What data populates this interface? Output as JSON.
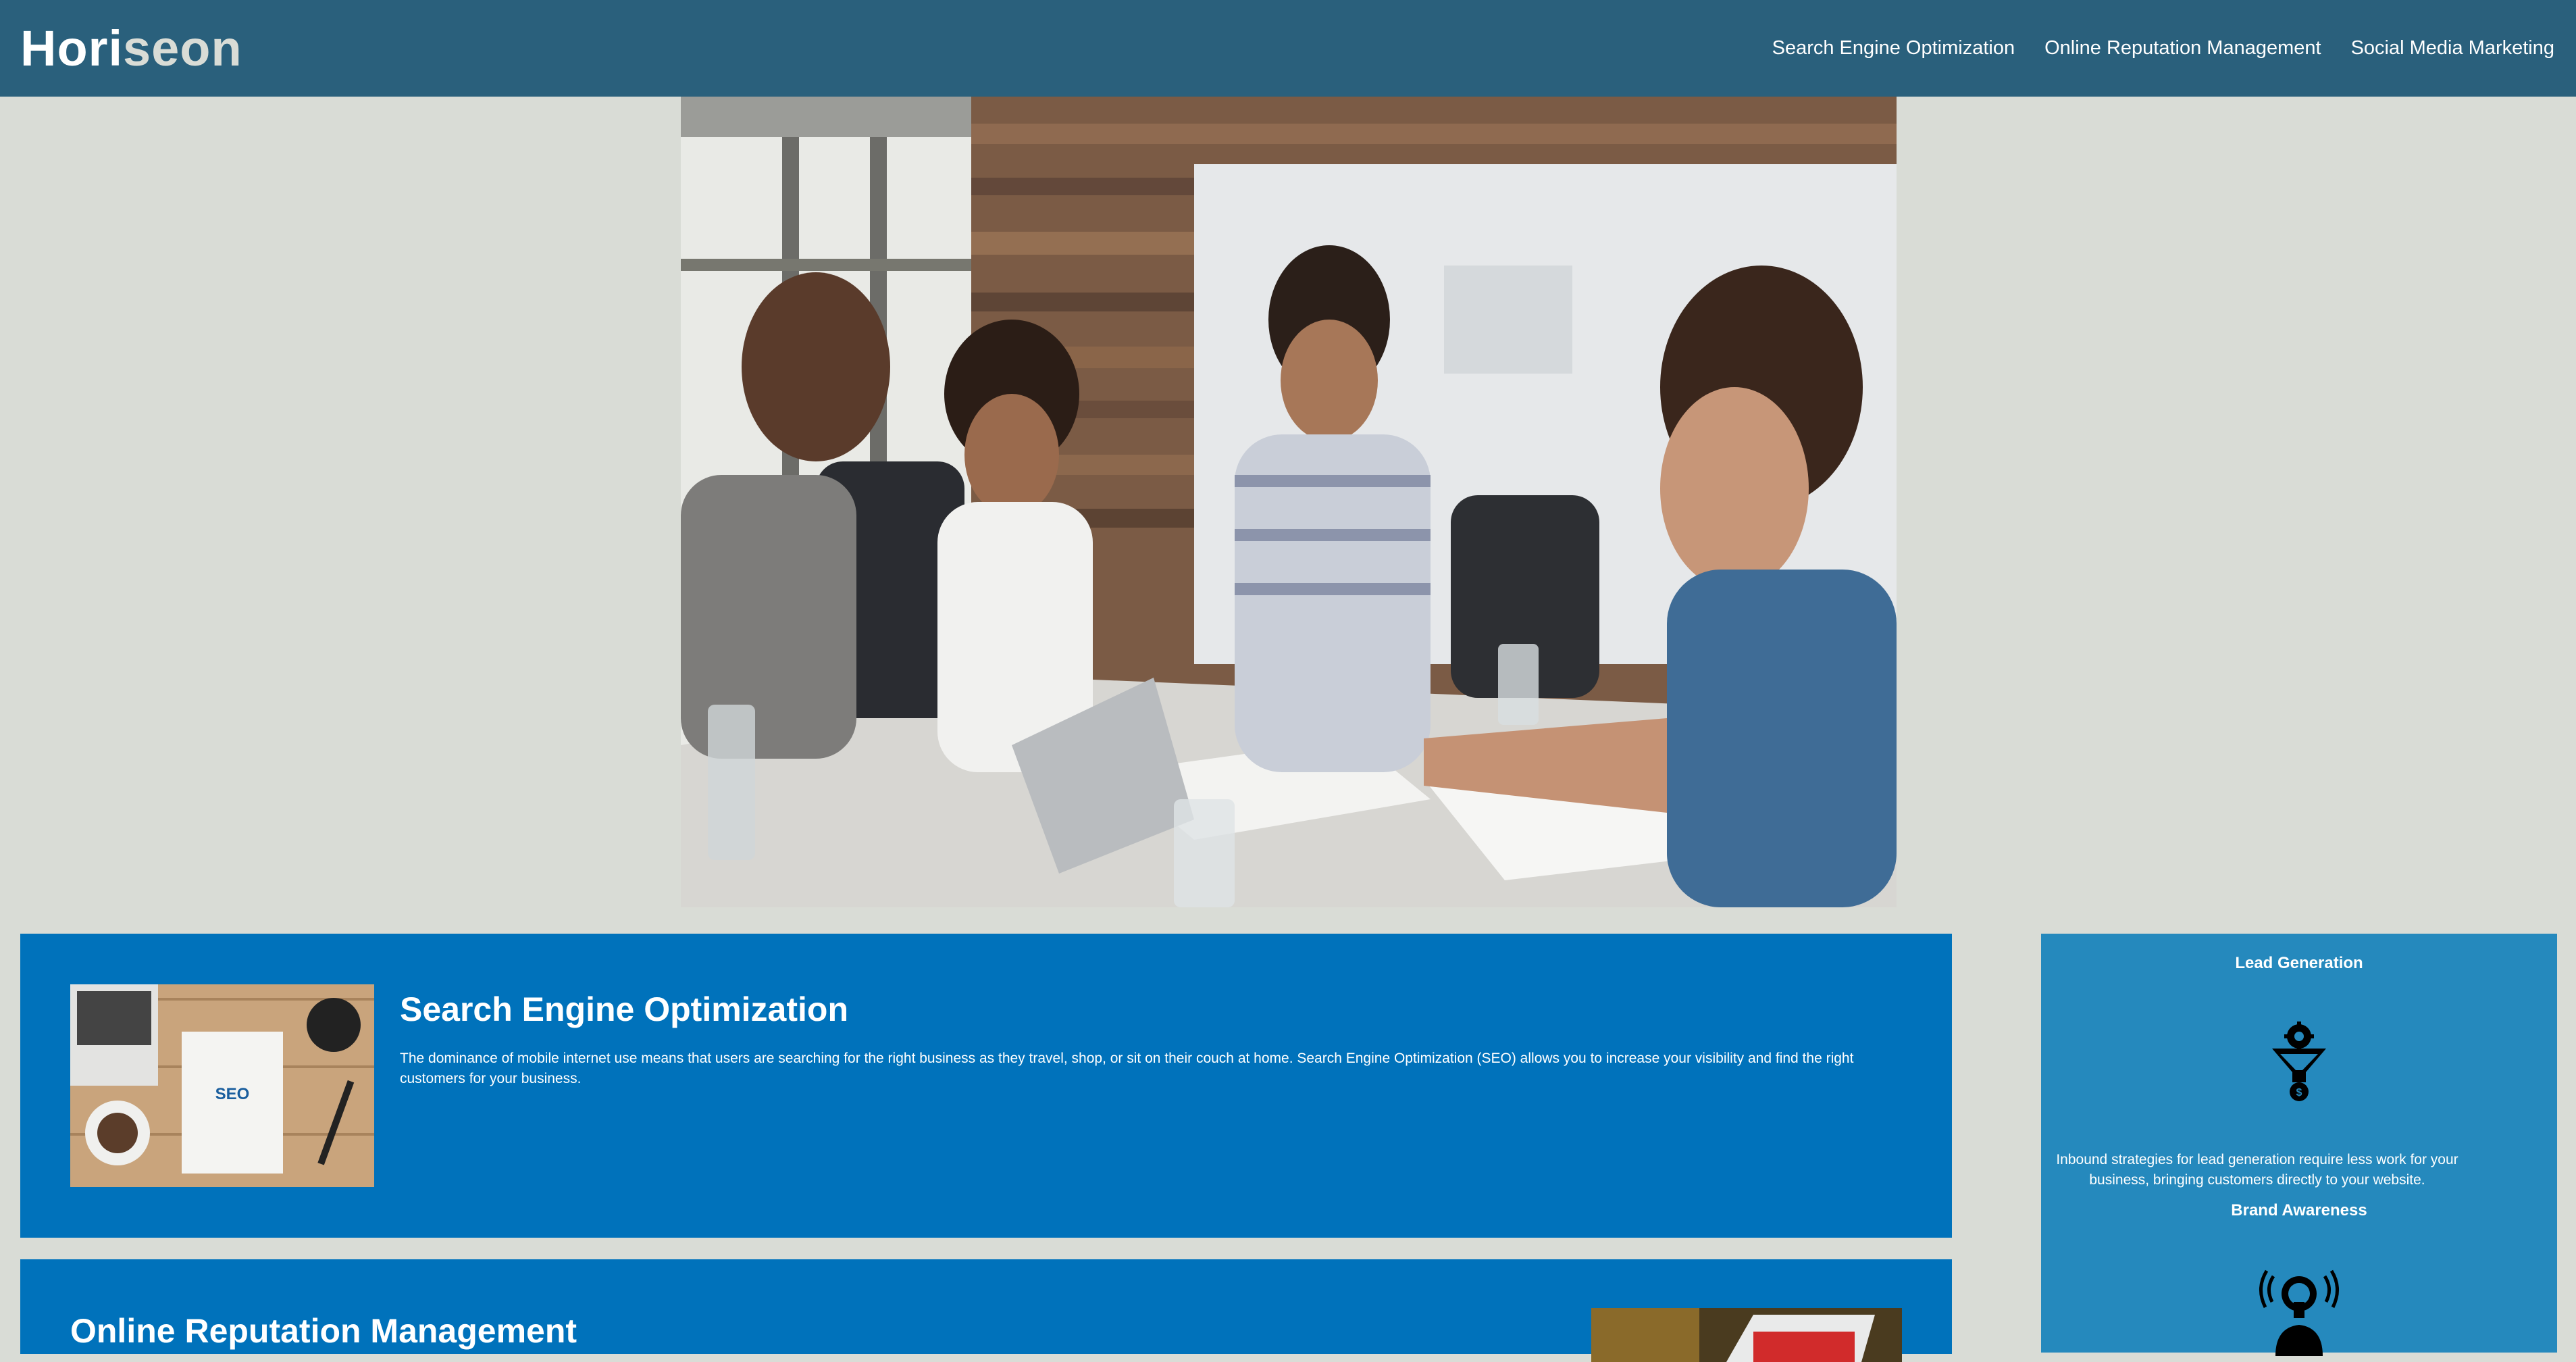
{
  "header": {
    "brand_prefix": "Hori",
    "brand_suffix": "seon",
    "nav": [
      "Search Engine Optimization",
      "Online Reputation Management",
      "Social Media Marketing"
    ]
  },
  "hero": {
    "image": "team-meeting-photo"
  },
  "main": {
    "seo": {
      "image": "seo-workspace-photo",
      "title": "Search Engine Optimization",
      "text": "The dominance of mobile internet use means that users are searching for the right business as they travel, shop, or sit on their couch at home. Search Engine Optimization (SEO) allows you to increase your visibility and find the right customers for your business."
    },
    "orm": {
      "title": "Online Reputation Management",
      "image": "reputation-laptop-photo"
    }
  },
  "aside": {
    "lead_generation": {
      "title": "Lead Generation",
      "icon": "lead-funnel-icon",
      "text": "Inbound strategies for lead generation require less work for your business, bringing customers directly to your website."
    },
    "brand_awareness": {
      "title": "Brand Awareness",
      "icon": "lightbulb-person-icon"
    }
  },
  "colors": {
    "page_bg": "#d9dcd6",
    "header_bg": "#2a607c",
    "card_bg": "#0072bb",
    "aside_bg": "#2589bd",
    "text": "#ffffff"
  }
}
